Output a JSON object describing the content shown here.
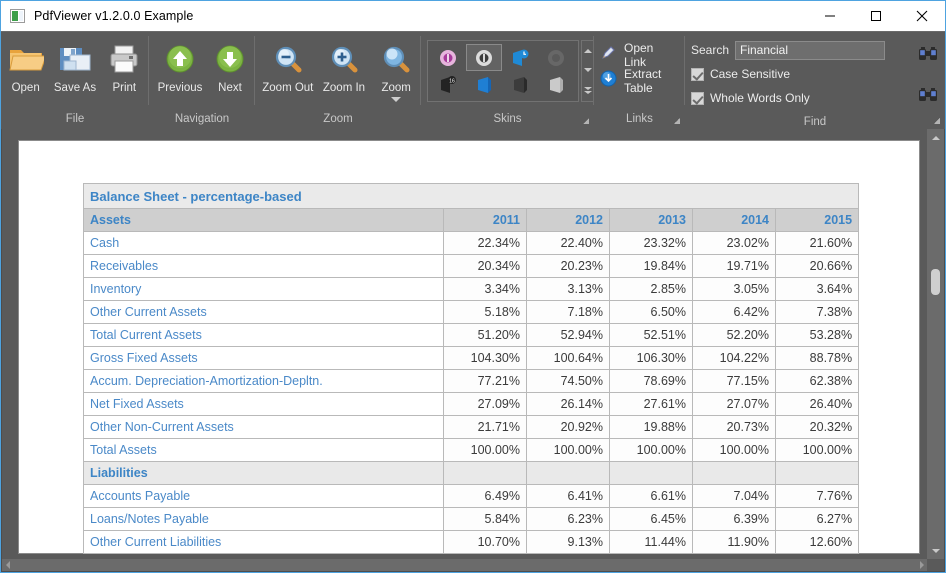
{
  "window": {
    "title": "PdfViewer v1.2.0.0 Example",
    "app_icon": "pdfviewer-icon",
    "minimize": "minimize-icon",
    "maximize": "maximize-icon",
    "close": "close-icon"
  },
  "ribbon": {
    "groups": [
      {
        "id": "file",
        "caption": "File"
      },
      {
        "id": "navigation",
        "caption": "Navigation"
      },
      {
        "id": "zoom",
        "caption": "Zoom"
      },
      {
        "id": "skins",
        "caption": "Skins"
      },
      {
        "id": "links",
        "caption": "Links"
      },
      {
        "id": "find",
        "caption": "Find"
      }
    ],
    "file": {
      "buttons": [
        {
          "label": "Open",
          "icon": "open-folder-icon"
        },
        {
          "label": "Save As",
          "icon": "save-disk-icon"
        },
        {
          "label": "Print",
          "icon": "printer-icon"
        }
      ]
    },
    "navigation": {
      "buttons": [
        {
          "label": "Previous",
          "icon": "arrow-up-circle-icon"
        },
        {
          "label": "Next",
          "icon": "arrow-down-circle-icon"
        }
      ]
    },
    "zoom": {
      "buttons": [
        {
          "label": "Zoom Out",
          "icon": "magnifier-minus-icon"
        },
        {
          "label": "Zoom In",
          "icon": "magnifier-plus-icon"
        },
        {
          "label": "Zoom",
          "icon": "magnifier-icon",
          "dropdown": true
        }
      ]
    },
    "skins": {
      "items": [
        {
          "name": "skin-pink",
          "color": "#e29ed2",
          "selected": false
        },
        {
          "name": "skin-gray",
          "color": "#d9d9d9",
          "selected": true
        },
        {
          "name": "skin-blue-365",
          "color": "#2b8fd9",
          "selected": false
        },
        {
          "name": "skin-faded",
          "color": "#6e6e6e",
          "selected": false
        },
        {
          "name": "skin-dark-16",
          "color": "#2b2b2b",
          "selected": false
        },
        {
          "name": "skin-office-blue",
          "color": "#1f7fd4",
          "selected": false
        },
        {
          "name": "skin-office-dark",
          "color": "#3c3c3c",
          "selected": false
        },
        {
          "name": "skin-office-light",
          "color": "#c9c9c9",
          "selected": false
        }
      ],
      "scroll_up": "scroll-up-icon",
      "scroll_down": "scroll-down-icon",
      "scroll_more": "scroll-more-icon"
    },
    "links": {
      "items": [
        {
          "label": "Open Link",
          "icon": "open-link-icon"
        },
        {
          "label": "Extract Table",
          "icon": "extract-table-icon"
        }
      ]
    },
    "find": {
      "search_label": "Search",
      "search_value": "Financial",
      "search_placeholder": "",
      "case_sensitive": {
        "label": "Case Sensitive",
        "checked": true
      },
      "whole_words": {
        "label": "Whole Words Only",
        "checked": true
      },
      "find_next_icon": "binoculars-icon",
      "find_prev_icon": "binoculars-icon"
    }
  },
  "document": {
    "table": {
      "title": "Balance Sheet - percentage-based",
      "columns": [
        "",
        "2011",
        "2012",
        "2013",
        "2014",
        "2015"
      ],
      "section_assets": "Assets",
      "section_liabilities": "Liabilities",
      "asset_rows": [
        {
          "label": "Cash",
          "values": [
            "22.34%",
            "22.40%",
            "23.32%",
            "23.02%",
            "21.60%"
          ]
        },
        {
          "label": "Receivables",
          "values": [
            "20.34%",
            "20.23%",
            "19.84%",
            "19.71%",
            "20.66%"
          ]
        },
        {
          "label": "Inventory",
          "values": [
            "3.34%",
            "3.13%",
            "2.85%",
            "3.05%",
            "3.64%"
          ]
        },
        {
          "label": "Other Current Assets",
          "values": [
            "5.18%",
            "7.18%",
            "6.50%",
            "6.42%",
            "7.38%"
          ]
        },
        {
          "label": "Total Current Assets",
          "values": [
            "51.20%",
            "52.94%",
            "52.51%",
            "52.20%",
            "53.28%"
          ]
        },
        {
          "label": "Gross Fixed Assets",
          "values": [
            "104.30%",
            "100.64%",
            "106.30%",
            "104.22%",
            "88.78%"
          ]
        },
        {
          "label": "Accum. Depreciation-Amortization-Depltn.",
          "values": [
            "77.21%",
            "74.50%",
            "78.69%",
            "77.15%",
            "62.38%"
          ]
        },
        {
          "label": "Net Fixed Assets",
          "values": [
            "27.09%",
            "26.14%",
            "27.61%",
            "27.07%",
            "26.40%"
          ]
        },
        {
          "label": "Other Non-Current Assets",
          "values": [
            "21.71%",
            "20.92%",
            "19.88%",
            "20.73%",
            "20.32%"
          ]
        },
        {
          "label": "Total Assets",
          "values": [
            "100.00%",
            "100.00%",
            "100.00%",
            "100.00%",
            "100.00%"
          ]
        }
      ],
      "liability_rows": [
        {
          "label": "Accounts Payable",
          "values": [
            "6.49%",
            "6.41%",
            "6.61%",
            "7.04%",
            "7.76%"
          ]
        },
        {
          "label": "Loans/Notes Payable",
          "values": [
            "5.84%",
            "6.23%",
            "6.45%",
            "6.39%",
            "6.27%"
          ]
        },
        {
          "label": "Other Current Liabilities",
          "values": [
            "10.70%",
            "9.13%",
            "11.44%",
            "11.90%",
            "12.60%"
          ]
        }
      ]
    }
  },
  "scrollbars": {
    "vertical_up": "scroll-up-icon",
    "vertical_down": "scroll-down-icon",
    "horizontal_left": "scroll-left-icon",
    "horizontal_right": "scroll-right-icon"
  }
}
